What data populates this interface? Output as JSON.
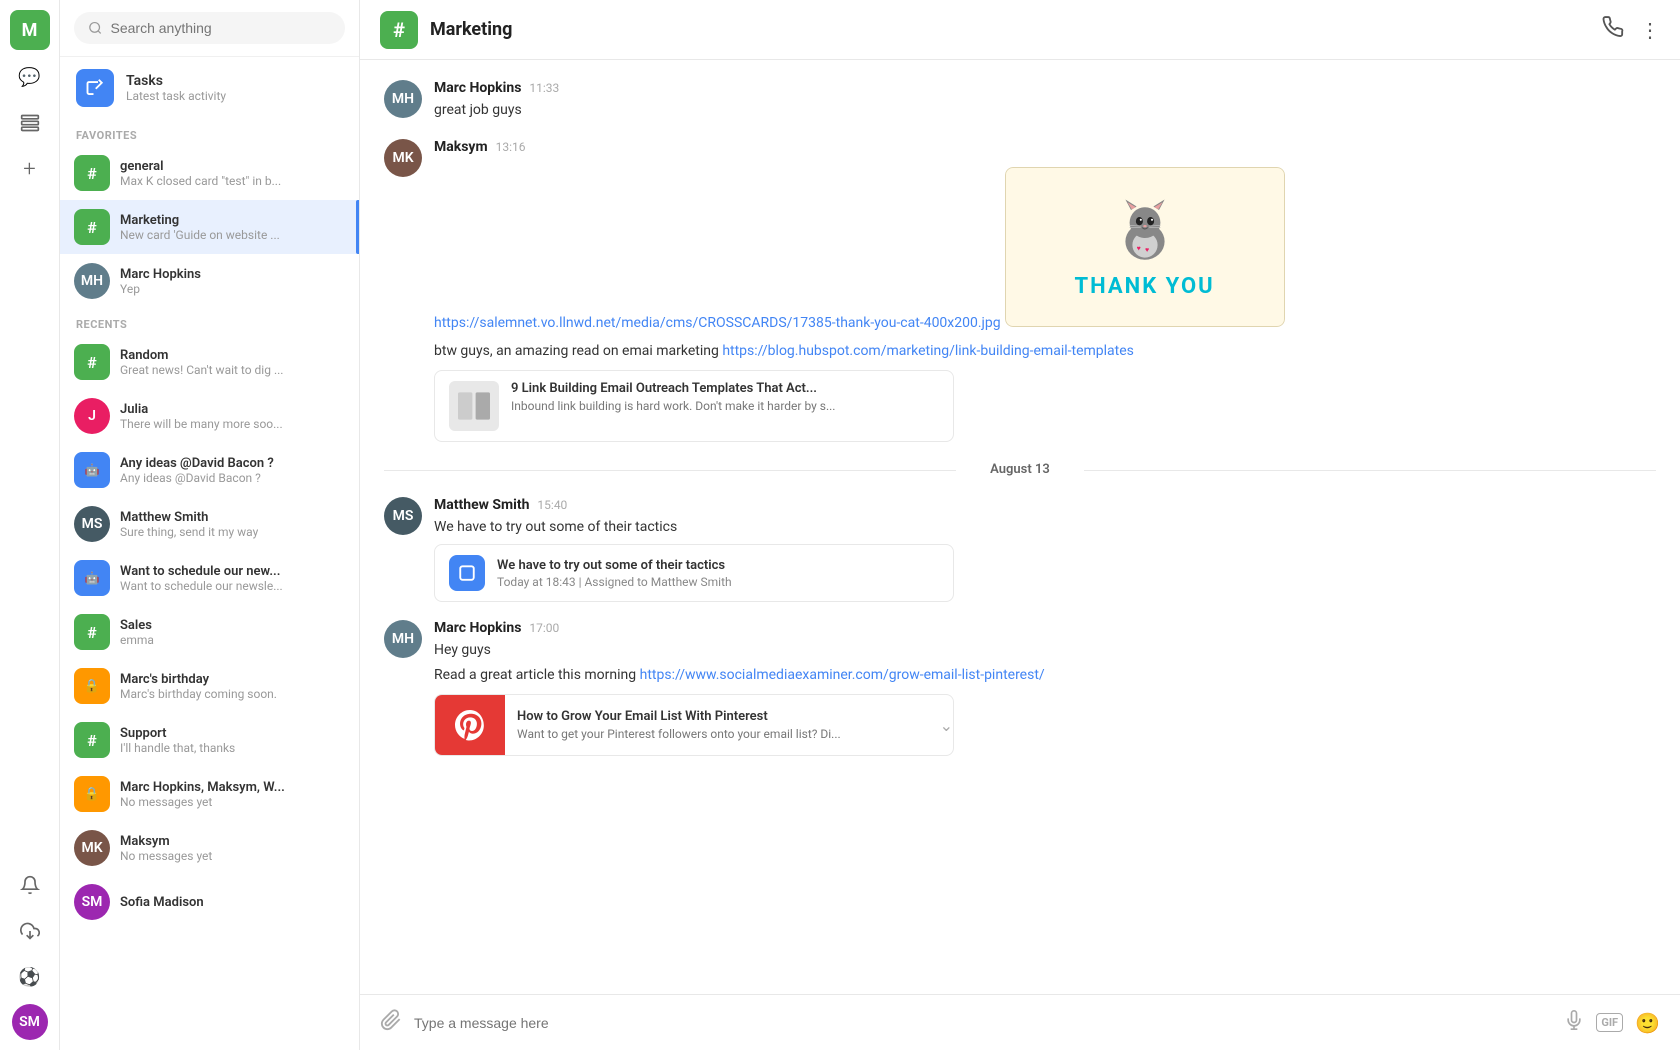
{
  "app": {
    "user_initial": "M",
    "title": "Marketing"
  },
  "sidebar_icons": [
    {
      "name": "chat-icon",
      "symbol": "💬",
      "active": true
    },
    {
      "name": "contacts-icon",
      "symbol": "👥",
      "active": false
    },
    {
      "name": "add-icon",
      "symbol": "+",
      "active": false
    }
  ],
  "search": {
    "placeholder": "Search anything"
  },
  "tasks": {
    "title": "Tasks",
    "subtitle": "Latest task activity"
  },
  "sections": {
    "favorites": "FAVORITES",
    "recents": "RECENTS"
  },
  "favorites": [
    {
      "id": "general",
      "type": "hash",
      "color": "green",
      "name": "general",
      "preview": "Max K closed card \"test\" in b..."
    },
    {
      "id": "marketing",
      "type": "hash",
      "color": "green",
      "name": "Marketing",
      "preview": "New card 'Guide on website ...",
      "active": true
    },
    {
      "id": "marc-hopkins",
      "type": "user",
      "color": "avatar-marc",
      "name": "Marc Hopkins",
      "preview": "Yep",
      "initials": "MH"
    }
  ],
  "recents": [
    {
      "id": "random",
      "type": "hash",
      "color": "green",
      "name": "Random",
      "preview": "Great news! Can't wait to dig ..."
    },
    {
      "id": "julia",
      "type": "user",
      "color": "avatar-julia",
      "name": "Julia",
      "preview": "There will be many more soo...",
      "initials": "J"
    },
    {
      "id": "david-bacon",
      "type": "bot",
      "color": "blue",
      "name": "Any ideas @David Bacon ?",
      "preview": "Any ideas @David Bacon ?"
    },
    {
      "id": "matthew-smith",
      "type": "user",
      "color": "avatar-matthew",
      "name": "Matthew Smith",
      "preview": "Sure thing, send it my way",
      "initials": "MS"
    },
    {
      "id": "schedule-newsletter",
      "type": "bot",
      "color": "blue",
      "name": "Want to schedule our new...",
      "preview": "Want to schedule our newsle..."
    },
    {
      "id": "sales",
      "type": "hash",
      "color": "green",
      "name": "Sales",
      "preview": "emma"
    },
    {
      "id": "marcs-birthday",
      "type": "lock",
      "color": "orange",
      "name": "Marc's birthday",
      "preview": "Marc's birthday coming soon."
    },
    {
      "id": "support",
      "type": "hash",
      "color": "green",
      "name": "Support",
      "preview": "I'll handle that, thanks"
    },
    {
      "id": "group-chat",
      "type": "lock",
      "color": "orange",
      "name": "Marc Hopkins, Maksym, W...",
      "preview": "No messages yet"
    },
    {
      "id": "maksym",
      "type": "user",
      "color": "avatar-maksym",
      "name": "Maksym",
      "preview": "No messages yet",
      "initials": "MK"
    },
    {
      "id": "sofia-madison",
      "type": "user",
      "color": "avatar-sofia",
      "name": "Sofia Madison",
      "preview": "",
      "initials": "SM"
    }
  ],
  "chat": {
    "channel_name": "Marketing",
    "messages": [
      {
        "id": "msg1",
        "author": "Marc Hopkins",
        "time": "11:33",
        "text": "great job guys",
        "avatar_initials": "MH",
        "avatar_color": "avatar-marc"
      },
      {
        "id": "msg2",
        "author": "Maksym",
        "time": "13:16",
        "link": "https://salemnet.vo.llnwd.net/media/cms/CROSSCARDS/17385-thank-you-cat-400x200.jpg",
        "has_image": true,
        "avatar_initials": "MK",
        "avatar_color": "avatar-maksym"
      },
      {
        "id": "msg3",
        "text_before_link": "btw guys, an amazing read on emai marketing",
        "link": "https://blog.hubspot.com/marketing/link-building-email-templates",
        "article_title": "9 Link Building Email Outreach Templates That Act...",
        "article_desc": "Inbound link building is hard work. Don't make it harder by s...",
        "is_continuation": true
      },
      {
        "id": "date-divider",
        "date_label": "August 13"
      },
      {
        "id": "msg4",
        "author": "Matthew Smith",
        "time": "15:40",
        "text": "We have to try out some of their tactics",
        "has_task": true,
        "task_title": "We have to try out some of their tactics",
        "task_meta": "Today at 18:43 | Assigned to Matthew Smith",
        "avatar_initials": "MS",
        "avatar_color": "avatar-matthew"
      },
      {
        "id": "msg5",
        "author": "Marc Hopkins",
        "time": "17:00",
        "text_line1": "Hey guys",
        "text_line2_before": "Read a great article this morning",
        "text_line2_link": "https://www.socialmediaexaminer.com/grow-email-list-pinterest/",
        "article_title": "How to Grow Your Email List With Pinterest",
        "article_desc": "Want to get your Pinterest followers onto your email list? Di...",
        "avatar_initials": "MH",
        "avatar_color": "avatar-marc"
      }
    ]
  },
  "input": {
    "placeholder": "Type a message here"
  },
  "bottom_user": {
    "name": "Sofia Madison",
    "initials": "SM"
  }
}
